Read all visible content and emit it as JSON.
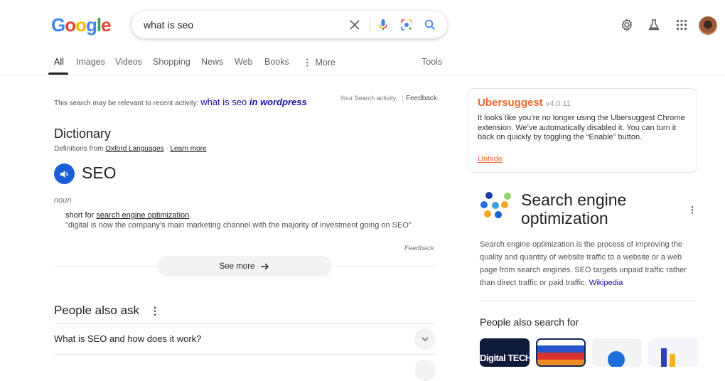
{
  "header": {
    "logo_letters": [
      {
        "ch": "G",
        "color": "#4285f4"
      },
      {
        "ch": "o",
        "color": "#ea4335"
      },
      {
        "ch": "o",
        "color": "#fbbc05"
      },
      {
        "ch": "g",
        "color": "#4285f4"
      },
      {
        "ch": "l",
        "color": "#34a853"
      },
      {
        "ch": "e",
        "color": "#ea4335"
      }
    ],
    "search_query": "what is seo",
    "search_icons": [
      "clear-icon",
      "voice-search-icon",
      "lens-icon",
      "search-icon"
    ],
    "right_icons": [
      "settings-icon",
      "labs-icon",
      "apps-icon",
      "avatar"
    ]
  },
  "tabs": {
    "items": [
      "All",
      "Images",
      "Videos",
      "Shopping",
      "News",
      "Web",
      "Books",
      "More"
    ],
    "active": "All",
    "tools_label": "Tools"
  },
  "recent_activity": {
    "prefix": "This search may be relevant to recent activity:",
    "query_plain": "what is seo",
    "query_bold": "in wordpress",
    "your_activity": "Your Search activity",
    "feedback": "Feedback"
  },
  "dictionary": {
    "title": "Dictionary",
    "source_prefix": "Definitions from",
    "source_link": "Oxford Languages",
    "separator": "·",
    "learn_more": "Learn more",
    "word": "SEO",
    "part_of_speech": "noun",
    "definition_prefix": "short for",
    "definition_link": "search engine optimization",
    "definition_suffix": ".",
    "example": "\"digital is now the company's main marketing channel with the majority of investment going on SEO\"",
    "feedback": "Feedback",
    "see_more": "See more"
  },
  "people_also_ask": {
    "title": "People also ask",
    "questions": [
      "What is SEO and how does it work?"
    ]
  },
  "ubersuggest": {
    "title": "Ubersuggest",
    "version": "v4.0.11",
    "body": "It looks like you’re no longer using the Ubersuggest Chrome extension. We’ve automatically disabled it. You can turn it back on quickly by toggling the “Enable” button.",
    "link": "Unhide",
    "accent_color": "#f06a2b"
  },
  "knowledge_panel": {
    "title": "Search engine optimization",
    "description": "Search engine optimization is the process of improving the quality and quantity of website traffic to a website or a web page from search engines. SEO targets unpaid traffic rather than direct traffic or paid traffic.",
    "source_link": "Wikipedia",
    "people_also_search_for": "People also search for",
    "thumb_image_text": "Digital TECHNOLOGY"
  }
}
